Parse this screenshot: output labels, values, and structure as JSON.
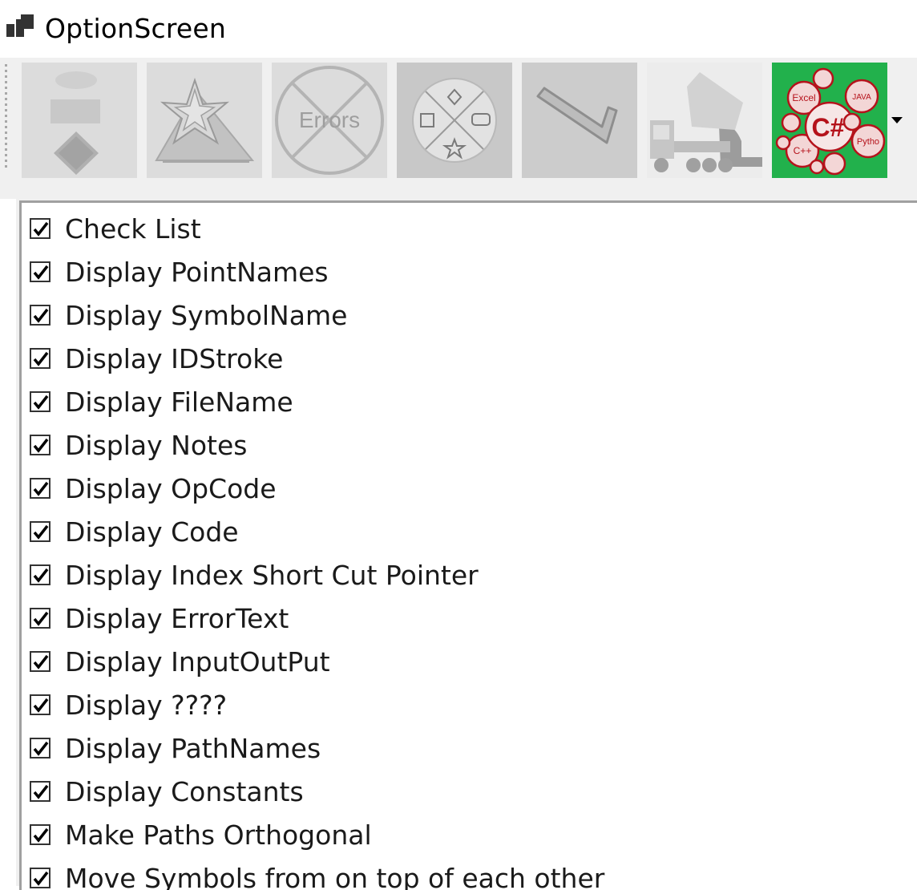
{
  "window": {
    "title": "OptionScreen"
  },
  "toolbar": {
    "buttons": [
      {
        "name": "flowchart-shapes-button",
        "icon": "flowchart-shapes-icon",
        "enabled": false
      },
      {
        "name": "stars-mountain-button",
        "icon": "stars-mountain-icon",
        "enabled": false
      },
      {
        "name": "errors-button",
        "icon": "errors-crossed-icon",
        "label": "Errors",
        "enabled": false
      },
      {
        "name": "shape-wheel-button",
        "icon": "shape-wheel-icon",
        "enabled": false
      },
      {
        "name": "path-line-button",
        "icon": "angled-line-icon",
        "enabled": false
      },
      {
        "name": "dump-truck-button",
        "icon": "dump-truck-icon",
        "enabled": false
      },
      {
        "name": "languages-button",
        "icon": "csharp-languages-icon",
        "enabled": true,
        "labels": [
          "C#",
          "Excel",
          "JAVA",
          "Pytho",
          "C++"
        ]
      }
    ],
    "overflow_icon": "chevron-down-icon"
  },
  "options": {
    "items": [
      {
        "label": "Check List",
        "checked": true
      },
      {
        "label": "Display PointNames",
        "checked": true
      },
      {
        "label": "Display SymbolName",
        "checked": true
      },
      {
        "label": "Display IDStroke",
        "checked": true
      },
      {
        "label": "Display FileName",
        "checked": true
      },
      {
        "label": "Display Notes",
        "checked": true
      },
      {
        "label": "Display OpCode",
        "checked": true
      },
      {
        "label": "Display Code",
        "checked": true
      },
      {
        "label": "Display Index Short Cut Pointer",
        "checked": true
      },
      {
        "label": "Display ErrorText",
        "checked": true
      },
      {
        "label": "Display InputOutPut",
        "checked": true
      },
      {
        "label": "Display ????",
        "checked": true
      },
      {
        "label": "Display PathNames",
        "checked": true
      },
      {
        "label": "Display Constants",
        "checked": true
      },
      {
        "label": "Make Paths Orthogonal",
        "checked": true
      },
      {
        "label": "Move Symbols from on top of each other",
        "checked": true
      }
    ]
  },
  "colors": {
    "toolbar_bg": "#f0f0f0",
    "disabled_button_bg": "#dcdcdc",
    "active_button_bg": "#22b14c",
    "active_icon_color": "#b5121b"
  }
}
